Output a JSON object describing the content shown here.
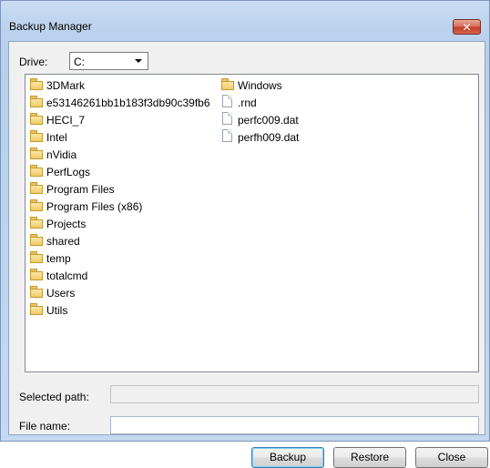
{
  "window": {
    "title": "Backup Manager",
    "close_glyph": "✕"
  },
  "drive": {
    "label": "Drive:",
    "value": "C:"
  },
  "files": {
    "column1": [
      {
        "name": "3DMark",
        "type": "folder"
      },
      {
        "name": "e53146261bb1b183f3db90c39fb6",
        "type": "folder"
      },
      {
        "name": "HECI_7",
        "type": "folder"
      },
      {
        "name": "Intel",
        "type": "folder"
      },
      {
        "name": "nVidia",
        "type": "folder"
      },
      {
        "name": "PerfLogs",
        "type": "folder"
      },
      {
        "name": "Program Files",
        "type": "folder"
      },
      {
        "name": "Program Files (x86)",
        "type": "folder"
      },
      {
        "name": "Projects",
        "type": "folder"
      },
      {
        "name": "shared",
        "type": "folder"
      },
      {
        "name": "temp",
        "type": "folder"
      },
      {
        "name": "totalcmd",
        "type": "folder"
      },
      {
        "name": "Users",
        "type": "folder"
      },
      {
        "name": "Utils",
        "type": "folder"
      }
    ],
    "column2": [
      {
        "name": "Windows",
        "type": "folder"
      },
      {
        "name": ".rnd",
        "type": "file"
      },
      {
        "name": "perfc009.dat",
        "type": "file"
      },
      {
        "name": "perfh009.dat",
        "type": "file"
      }
    ]
  },
  "selected_path": {
    "label": "Selected path:",
    "value": ""
  },
  "file_name": {
    "label": "File name:",
    "value": ""
  },
  "buttons": {
    "backup": "Backup",
    "restore": "Restore",
    "close": "Close"
  }
}
